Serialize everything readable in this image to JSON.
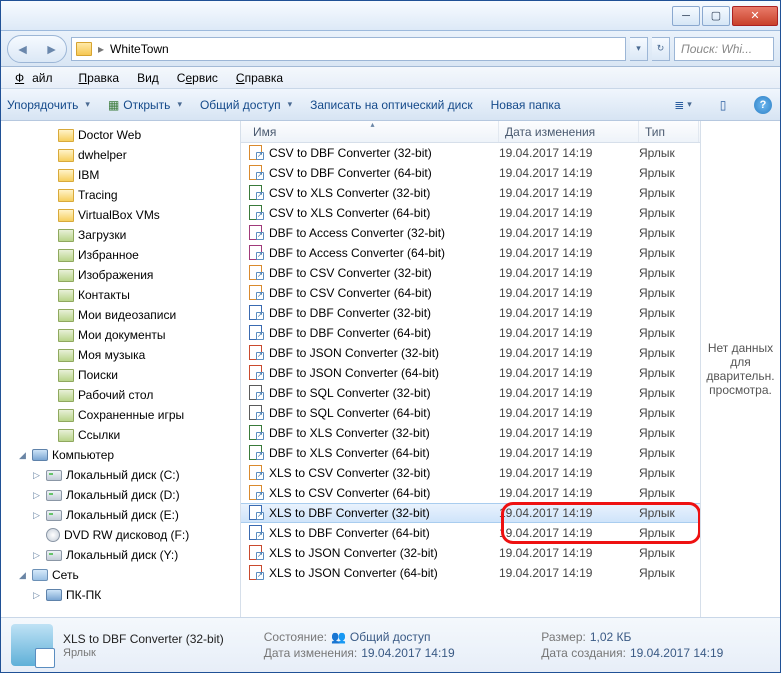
{
  "breadcrumb": "WhiteTown",
  "search_placeholder": "Поиск: Whi...",
  "menu": {
    "file": "Файл",
    "edit": "Правка",
    "view": "Вид",
    "tools": "Сервис",
    "help": "Справка"
  },
  "toolbar": {
    "organize": "Упорядочить",
    "open": "Открыть",
    "share": "Общий доступ",
    "burn": "Записать на оптический диск",
    "newfolder": "Новая папка"
  },
  "columns": {
    "name": "Имя",
    "modified": "Дата изменения",
    "type": "Тип"
  },
  "tree": [
    {
      "label": "Doctor Web",
      "indent": 40,
      "icon": "folder"
    },
    {
      "label": "dwhelper",
      "indent": 40,
      "icon": "folder"
    },
    {
      "label": "IBM",
      "indent": 40,
      "icon": "folder"
    },
    {
      "label": "Tracing",
      "indent": 40,
      "icon": "folder"
    },
    {
      "label": "VirtualBox VMs",
      "indent": 40,
      "icon": "folder"
    },
    {
      "label": "Загрузки",
      "indent": 40,
      "icon": "spec"
    },
    {
      "label": "Избранное",
      "indent": 40,
      "icon": "spec"
    },
    {
      "label": "Изображения",
      "indent": 40,
      "icon": "spec"
    },
    {
      "label": "Контакты",
      "indent": 40,
      "icon": "spec"
    },
    {
      "label": "Мои видеозаписи",
      "indent": 40,
      "icon": "spec"
    },
    {
      "label": "Мои документы",
      "indent": 40,
      "icon": "spec"
    },
    {
      "label": "Моя музыка",
      "indent": 40,
      "icon": "spec"
    },
    {
      "label": "Поиски",
      "indent": 40,
      "icon": "spec"
    },
    {
      "label": "Рабочий стол",
      "indent": 40,
      "icon": "spec"
    },
    {
      "label": "Сохраненные игры",
      "indent": 40,
      "icon": "spec"
    },
    {
      "label": "Ссылки",
      "indent": 40,
      "icon": "spec"
    },
    {
      "label": "Компьютер",
      "indent": 14,
      "icon": "comp",
      "exp": "◢"
    },
    {
      "label": "Локальный диск (C:)",
      "indent": 28,
      "icon": "drive",
      "exp": "▷"
    },
    {
      "label": "Локальный диск (D:)",
      "indent": 28,
      "icon": "drive",
      "exp": "▷"
    },
    {
      "label": "Локальный диск (E:)",
      "indent": 28,
      "icon": "drive",
      "exp": "▷"
    },
    {
      "label": "DVD RW дисковод (F:)",
      "indent": 28,
      "icon": "dvd"
    },
    {
      "label": "Локальный диск (Y:)",
      "indent": 28,
      "icon": "drive",
      "exp": "▷"
    },
    {
      "label": "Сеть",
      "indent": 14,
      "icon": "net",
      "exp": "◢"
    },
    {
      "label": "ПК-ПК",
      "indent": 28,
      "icon": "comp",
      "exp": "▷"
    }
  ],
  "files": [
    {
      "name": "CSV to DBF Converter (32-bit)",
      "date": "19.04.2017 14:19",
      "type": "Ярлык",
      "c": "#d98a2e"
    },
    {
      "name": "CSV to DBF Converter (64-bit)",
      "date": "19.04.2017 14:19",
      "type": "Ярлык",
      "c": "#d98a2e"
    },
    {
      "name": "CSV to XLS Converter (32-bit)",
      "date": "19.04.2017 14:19",
      "type": "Ярлык",
      "c": "#3a7a3a"
    },
    {
      "name": "CSV to XLS Converter (64-bit)",
      "date": "19.04.2017 14:19",
      "type": "Ярлык",
      "c": "#3a7a3a"
    },
    {
      "name": "DBF to Access Converter (32-bit)",
      "date": "19.04.2017 14:19",
      "type": "Ярлык",
      "c": "#a03a7a"
    },
    {
      "name": "DBF to Access Converter (64-bit)",
      "date": "19.04.2017 14:19",
      "type": "Ярлык",
      "c": "#a03a7a"
    },
    {
      "name": "DBF to CSV Converter (32-bit)",
      "date": "19.04.2017 14:19",
      "type": "Ярлык",
      "c": "#d98a2e"
    },
    {
      "name": "DBF to CSV Converter (64-bit)",
      "date": "19.04.2017 14:19",
      "type": "Ярлык",
      "c": "#d98a2e"
    },
    {
      "name": "DBF to DBF Converter (32-bit)",
      "date": "19.04.2017 14:19",
      "type": "Ярлык",
      "c": "#3a6ab0"
    },
    {
      "name": "DBF to DBF Converter (64-bit)",
      "date": "19.04.2017 14:19",
      "type": "Ярлык",
      "c": "#3a6ab0"
    },
    {
      "name": "DBF to JSON Converter (32-bit)",
      "date": "19.04.2017 14:19",
      "type": "Ярлык",
      "c": "#c94a2e"
    },
    {
      "name": "DBF to JSON Converter (64-bit)",
      "date": "19.04.2017 14:19",
      "type": "Ярлык",
      "c": "#c94a2e"
    },
    {
      "name": "DBF to SQL Converter (32-bit)",
      "date": "19.04.2017 14:19",
      "type": "Ярлык",
      "c": "#5a5a5a"
    },
    {
      "name": "DBF to SQL Converter (64-bit)",
      "date": "19.04.2017 14:19",
      "type": "Ярлык",
      "c": "#5a5a5a"
    },
    {
      "name": "DBF to XLS Converter (32-bit)",
      "date": "19.04.2017 14:19",
      "type": "Ярлык",
      "c": "#3a7a3a"
    },
    {
      "name": "DBF to XLS Converter (64-bit)",
      "date": "19.04.2017 14:19",
      "type": "Ярлык",
      "c": "#3a7a3a"
    },
    {
      "name": "XLS to CSV Converter (32-bit)",
      "date": "19.04.2017 14:19",
      "type": "Ярлык",
      "c": "#d98a2e"
    },
    {
      "name": "XLS to CSV Converter (64-bit)",
      "date": "19.04.2017 14:19",
      "type": "Ярлык",
      "c": "#d98a2e"
    },
    {
      "name": "XLS to DBF Converter (32-bit)",
      "date": "19.04.2017 14:19",
      "type": "Ярлык",
      "c": "#3a6ab0",
      "sel": true
    },
    {
      "name": "XLS to DBF Converter (64-bit)",
      "date": "19.04.2017 14:19",
      "type": "Ярлык",
      "c": "#3a6ab0"
    },
    {
      "name": "XLS to JSON Converter (32-bit)",
      "date": "19.04.2017 14:19",
      "type": "Ярлык",
      "c": "#c94a2e"
    },
    {
      "name": "XLS to JSON Converter (64-bit)",
      "date": "19.04.2017 14:19",
      "type": "Ярлык",
      "c": "#c94a2e"
    }
  ],
  "preview_text": "Нет данных для дварительн. просмотра.",
  "status": {
    "name": "XLS to DBF Converter (32-bit)",
    "type": "Ярлык",
    "state_lbl": "Состояние:",
    "state_val": "Общий доступ",
    "mod_lbl": "Дата изменения:",
    "mod_val": "19.04.2017 14:19",
    "size_lbl": "Размер:",
    "size_val": "1,02 КБ",
    "created_lbl": "Дата создания:",
    "created_val": "19.04.2017 14:19"
  }
}
